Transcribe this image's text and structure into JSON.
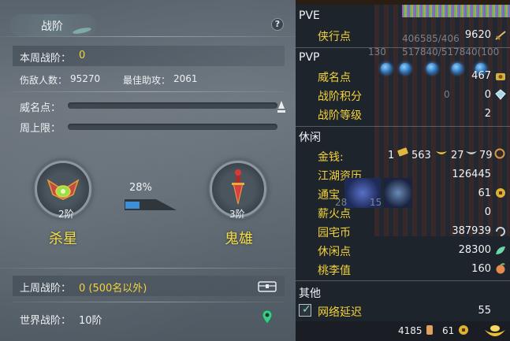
{
  "left_panel": {
    "title": "战阶",
    "help": "?",
    "this_week_label": "本周战阶：",
    "this_week_value": "0",
    "defeated_label": "伤敌人数：",
    "defeated_value": "95270",
    "best_assist_label": "最佳助攻：",
    "best_assist_value": "2061",
    "prestige_label": "威名点：",
    "weekly_cap_label": "周上限：",
    "emblem_left_rank": "2阶",
    "emblem_left_name": "杀星",
    "emblem_right_rank": "3阶",
    "emblem_right_name": "鬼雄",
    "progress_pct": "28%",
    "progress_fraction": 0.28,
    "last_week_label": "上周战阶：",
    "last_week_value": "0 (500名以外)",
    "world_label": "世界战阶：",
    "world_value": "10阶"
  },
  "right_panel": {
    "pve_header": "PVE",
    "chivalry_label": "侠行点",
    "chivalry_value": "9620",
    "overlay_hp1": "406585/406",
    "overlay_hp2": "517840/517840(100",
    "overlay_lvl": "130",
    "pvp_header": "PVP",
    "prestige_label": "威名点",
    "prestige_value": "467",
    "rank_points_label": "战阶积分",
    "rank_points_value": "0",
    "rank_level_label": "战阶等级",
    "rank_level_value": "2",
    "overlay_zero": "0",
    "leisure_header": "休闲",
    "money_label": "金钱:",
    "money_gold": "1",
    "money_silver": "563",
    "money_copper": "27",
    "money_extra": "79",
    "jianghu_label": "江湖资历",
    "jianghu_value": "126445",
    "tongbao_label": "通宝",
    "tongbao_value": "61",
    "overlay_28": "28",
    "overlay_15": "15",
    "firewood_label": "薪火点",
    "firewood_value": "0",
    "garden_label": "园宅币",
    "garden_value": "387939",
    "leisure_pts_label": "休闲点",
    "leisure_pts_value": "28300",
    "peach_label": "桃李值",
    "peach_value": "160",
    "other_header": "其他",
    "latency_label": "网络延迟",
    "latency_value": "55",
    "bottom_count": "4185",
    "bottom_coins": "61"
  },
  "colors": {
    "accent_yellow": "#f3d23c",
    "panel_dark": "#1e242b",
    "progress_blue": "#3f8fd8"
  }
}
